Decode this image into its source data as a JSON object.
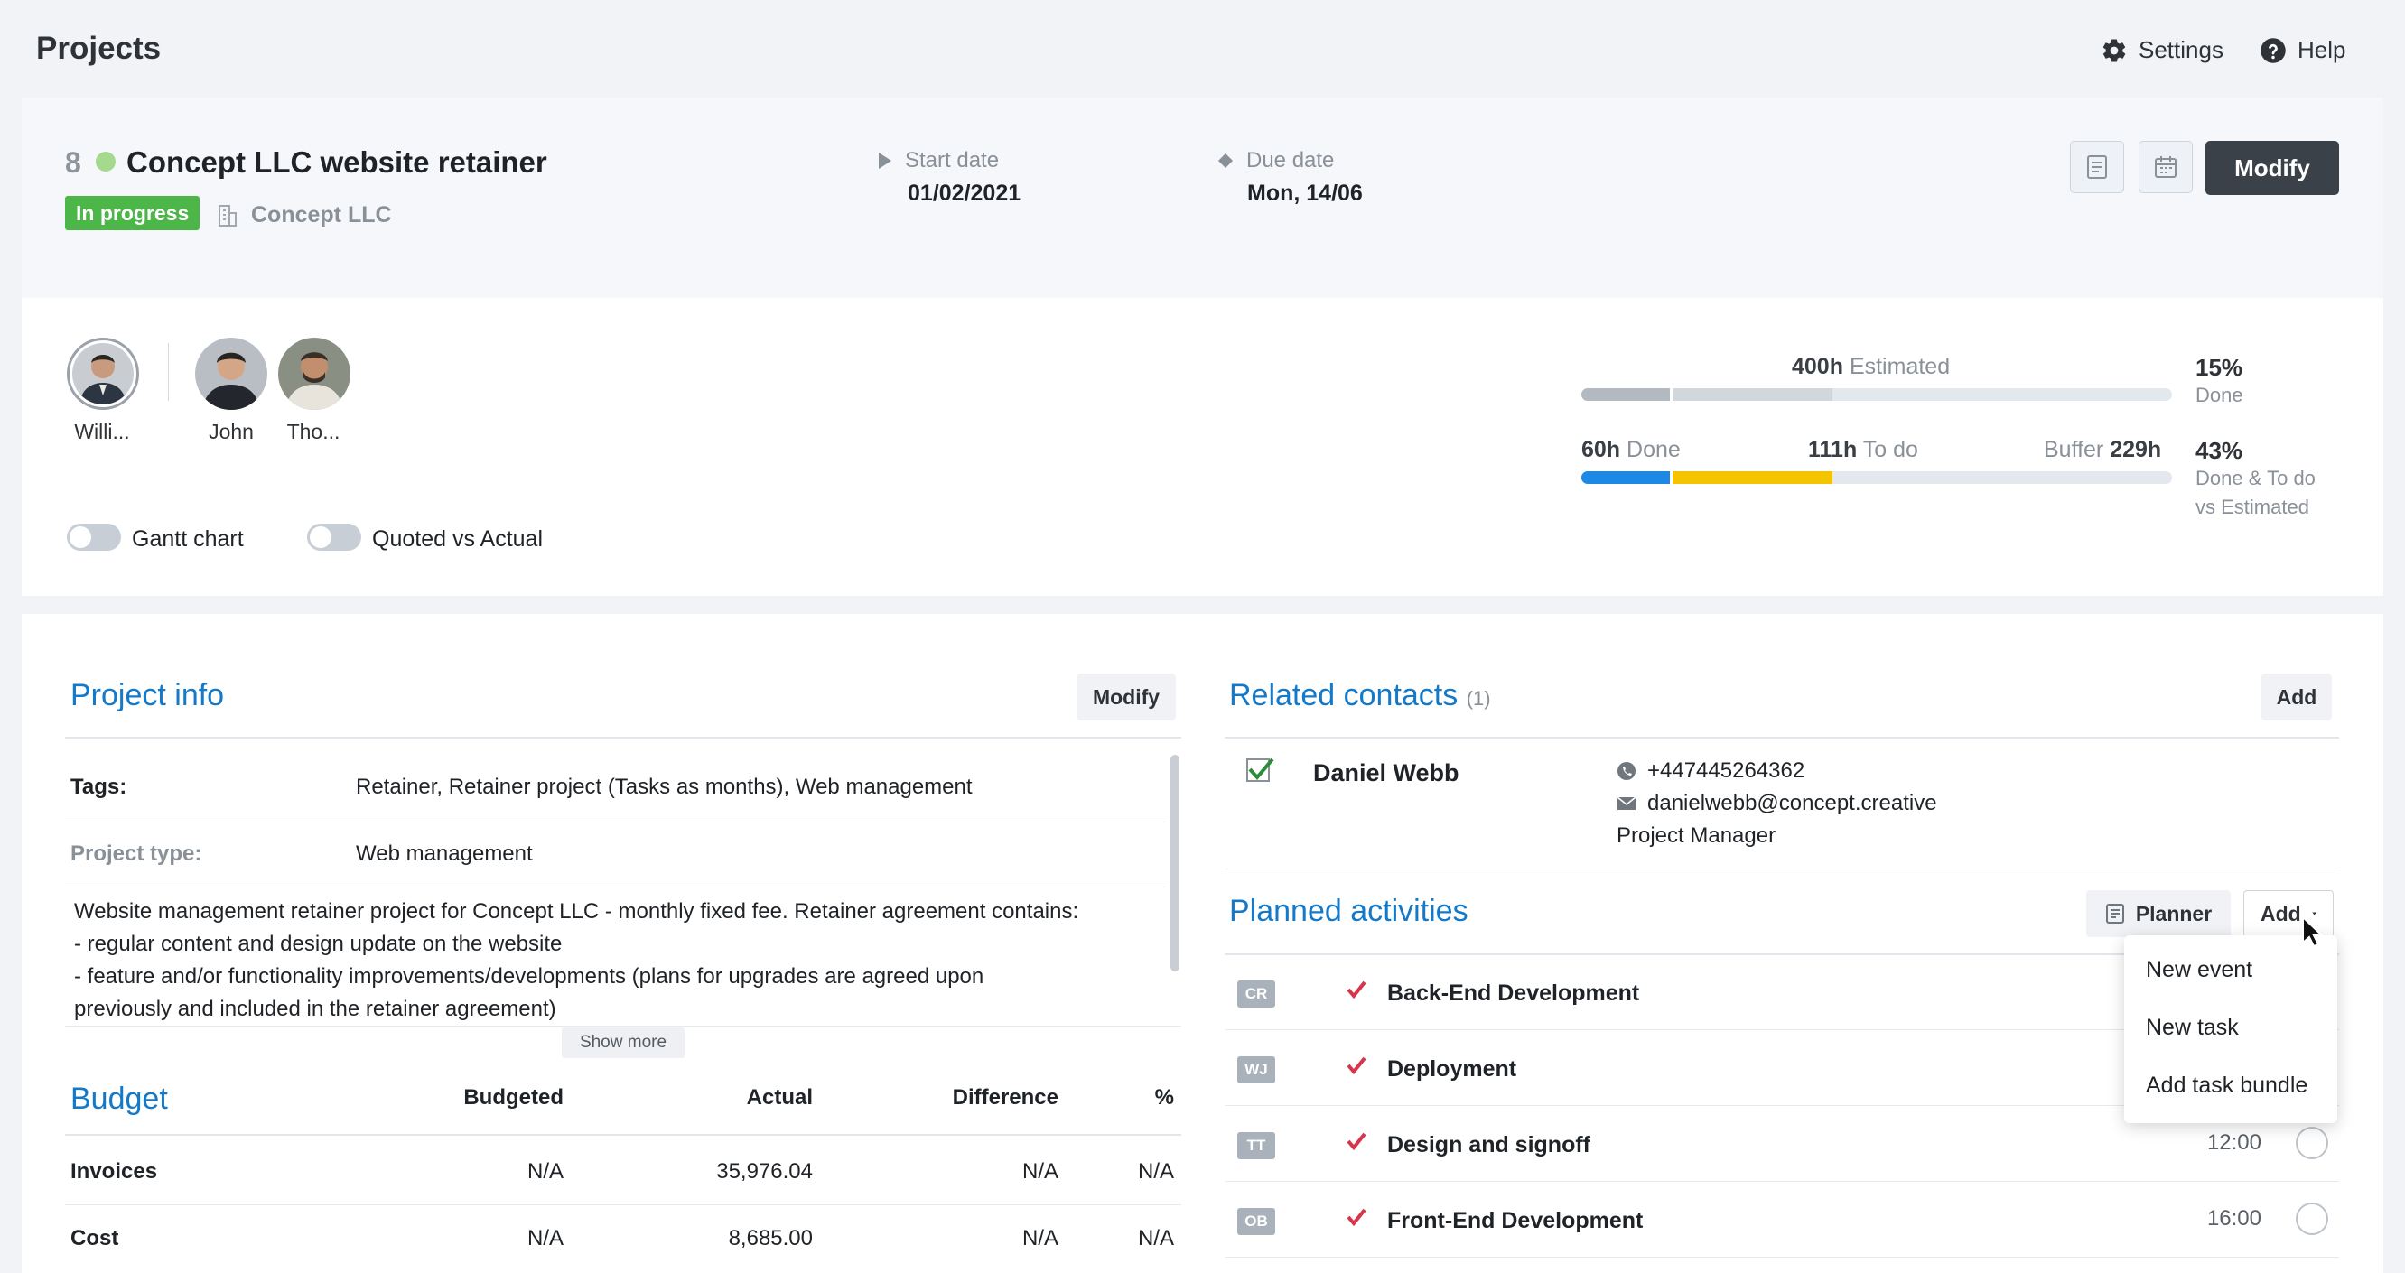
{
  "app": {
    "title": "Projects",
    "settings_label": "Settings",
    "help_label": "Help"
  },
  "project": {
    "id": "8",
    "name": "Concept LLC website retainer",
    "status": "In progress",
    "company": "Concept LLC",
    "start_label": "Start date",
    "start_value": "01/02/2021",
    "due_label": "Due date",
    "due_value": "Mon, 14/06",
    "modify_label": "Modify"
  },
  "team": [
    {
      "name": "Willi..."
    },
    {
      "name": "John"
    },
    {
      "name": "Tho..."
    }
  ],
  "toggles": {
    "gantt": "Gantt chart",
    "quoted": "Quoted vs Actual"
  },
  "hours": {
    "estimated_value": "400h",
    "estimated_label": "Estimated",
    "done_pct": "15%",
    "done_pct_label": "Done",
    "done_value": "60h",
    "done_label": "Done",
    "todo_value": "111h",
    "todo_label": "To do",
    "buffer_label": "Buffer",
    "buffer_value": "229h",
    "combined_pct": "43%",
    "combined_label_1": "Done & To do",
    "combined_label_2": "vs Estimated",
    "estimated_bar": {
      "done_fraction": 0.15,
      "todo_fraction": 0.27
    },
    "progress_bar": {
      "done_fraction": 0.15,
      "todo_fraction": 0.27
    },
    "colors": {
      "done": "#1e88e5",
      "todo": "#f5c400",
      "est_done": "#b3b9c1",
      "est_todo": "#d2d7de"
    }
  },
  "project_info": {
    "title": "Project info",
    "modify_label": "Modify",
    "tags_key": "Tags:",
    "tags_value": "Retainer, Retainer project (Tasks as months), Web management",
    "type_key": "Project type:",
    "type_value": "Web management",
    "description": [
      "Website management retainer project for Concept LLC - monthly fixed fee. Retainer agreement contains:",
      "- regular content and design update on the website",
      "- feature and/or functionality improvements/developments (plans for upgrades are agreed upon",
      "previously and included in the retainer agreement)"
    ],
    "show_more": "Show more"
  },
  "budget": {
    "title": "Budget",
    "headers": [
      "Budgeted",
      "Actual",
      "Difference",
      "%"
    ],
    "rows": [
      {
        "label": "Invoices",
        "cells": [
          "N/A",
          "35,976.04",
          "N/A",
          "N/A"
        ]
      },
      {
        "label": "Cost",
        "cells": [
          "N/A",
          "8,685.00",
          "N/A",
          "N/A"
        ]
      }
    ]
  },
  "contacts": {
    "title": "Related contacts",
    "count": "(1)",
    "add_label": "Add",
    "items": [
      {
        "name": "Daniel Webb",
        "phone": "+447445264362",
        "email": "danielwebb@concept.creative",
        "role": "Project Manager"
      }
    ]
  },
  "activities": {
    "title": "Planned activities",
    "planner_label": "Planner",
    "add_label": "Add",
    "items": [
      {
        "initials": "CR",
        "name": "Back-End Development",
        "time": ""
      },
      {
        "initials": "WJ",
        "name": "Deployment",
        "time": ""
      },
      {
        "initials": "TT",
        "name": "Design and signoff",
        "time": "12:00"
      },
      {
        "initials": "OB",
        "name": "Front-End Development",
        "time": "16:00"
      }
    ],
    "menu": [
      "New event",
      "New task",
      "Add task bundle"
    ]
  }
}
